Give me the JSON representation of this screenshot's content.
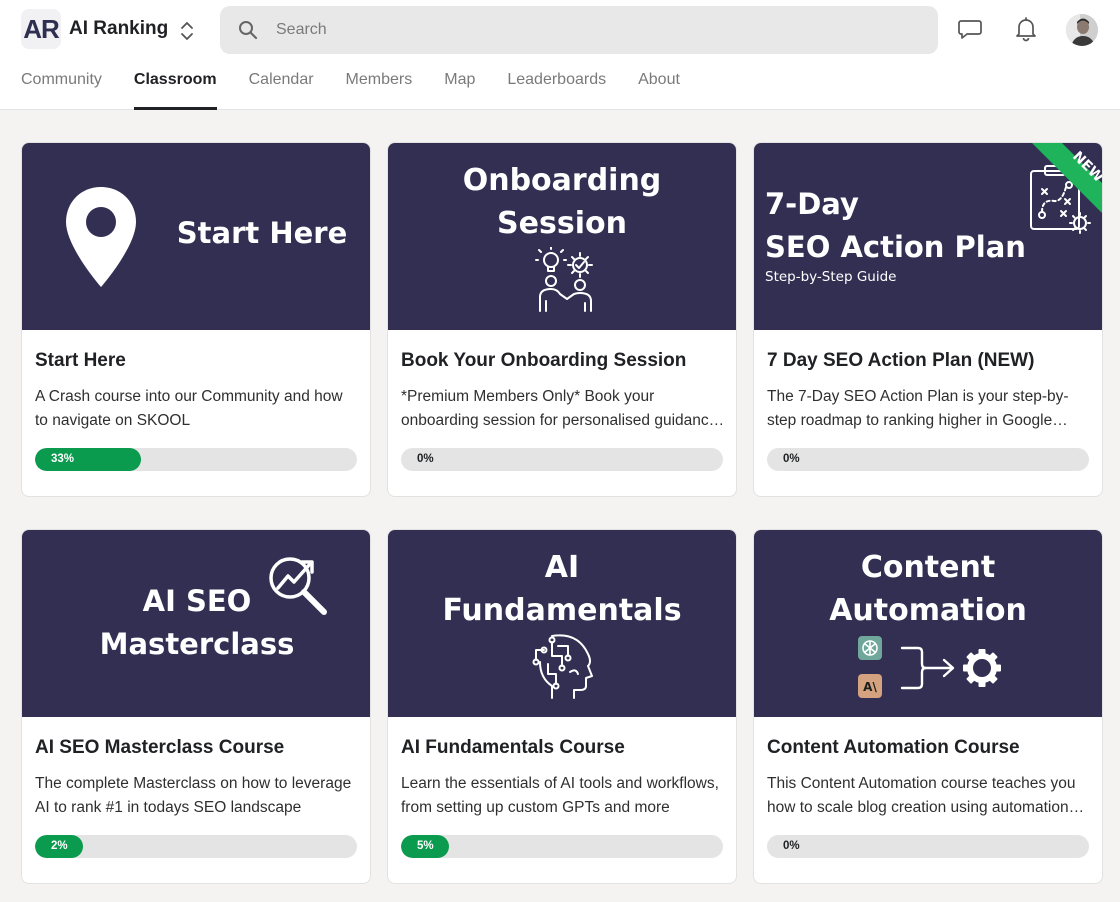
{
  "header": {
    "logo_initials": "AR",
    "group_name": "AI Ranking",
    "search_placeholder": "Search",
    "icons": [
      "switcher-chevrons-icon",
      "search-icon",
      "chat-icon",
      "bell-icon"
    ]
  },
  "tabs": [
    {
      "label": "Community",
      "active": false
    },
    {
      "label": "Classroom",
      "active": true
    },
    {
      "label": "Calendar",
      "active": false
    },
    {
      "label": "Members",
      "active": false
    },
    {
      "label": "Map",
      "active": false
    },
    {
      "label": "Leaderboards",
      "active": false
    },
    {
      "label": "About",
      "active": false
    }
  ],
  "colors": {
    "banner": "#332f53",
    "progress_fill": "#0a9b4f",
    "progress_track": "#e4e4e4",
    "new_ribbon": "#1fb45c"
  },
  "courses": [
    {
      "banner_lines": [
        "Start Here"
      ],
      "banner_icon": "location-pin-icon",
      "title": "Start Here",
      "description": "A Crash course into our Community and how to navigate on SKOOL",
      "progress": 0.33,
      "progress_label": "33%"
    },
    {
      "banner_lines": [
        "Onboarding",
        "Session"
      ],
      "banner_icon": "team-ideas-icon",
      "title": "Book Your Onboarding Session",
      "description": "*Premium Members Only* Book your onboarding session for personalised guidance on your journey",
      "progress": 0,
      "progress_label": "0%"
    },
    {
      "banner_lines": [
        "7-Day",
        "SEO Action Plan"
      ],
      "banner_subtitle": "Step-by-Step Guide",
      "banner_icon": "clipboard-plan-icon",
      "ribbon": "NEW",
      "title": "7 Day SEO Action Plan (NEW)",
      "description": "The 7-Day SEO Action Plan is your step-by-step roadmap to ranking higher in Google search results",
      "progress": 0,
      "progress_label": "0%"
    },
    {
      "banner_lines": [
        "AI SEO",
        "Masterclass"
      ],
      "banner_icon": "magnifier-growth-icon",
      "title": "AI SEO Masterclass Course",
      "description": "The complete Masterclass on how to leverage AI to rank #1 in todays SEO landscape",
      "progress": 0.02,
      "progress_label": "2%"
    },
    {
      "banner_lines": [
        "AI",
        "Fundamentals"
      ],
      "banner_icon": "ai-head-icon",
      "title": "AI Fundamentals Course",
      "description": "Learn the essentials of AI tools and workflows, from setting up custom GPTs and more",
      "progress": 0.05,
      "progress_label": "5%"
    },
    {
      "banner_lines": [
        "Content",
        "Automation"
      ],
      "banner_icon": "automation-flow-icon",
      "banner_badge_text": "A\\",
      "title": "Content Automation Course",
      "description": "This Content Automation course teaches you how to scale blog creation using automation tools",
      "progress": 0,
      "progress_label": "0%"
    }
  ]
}
